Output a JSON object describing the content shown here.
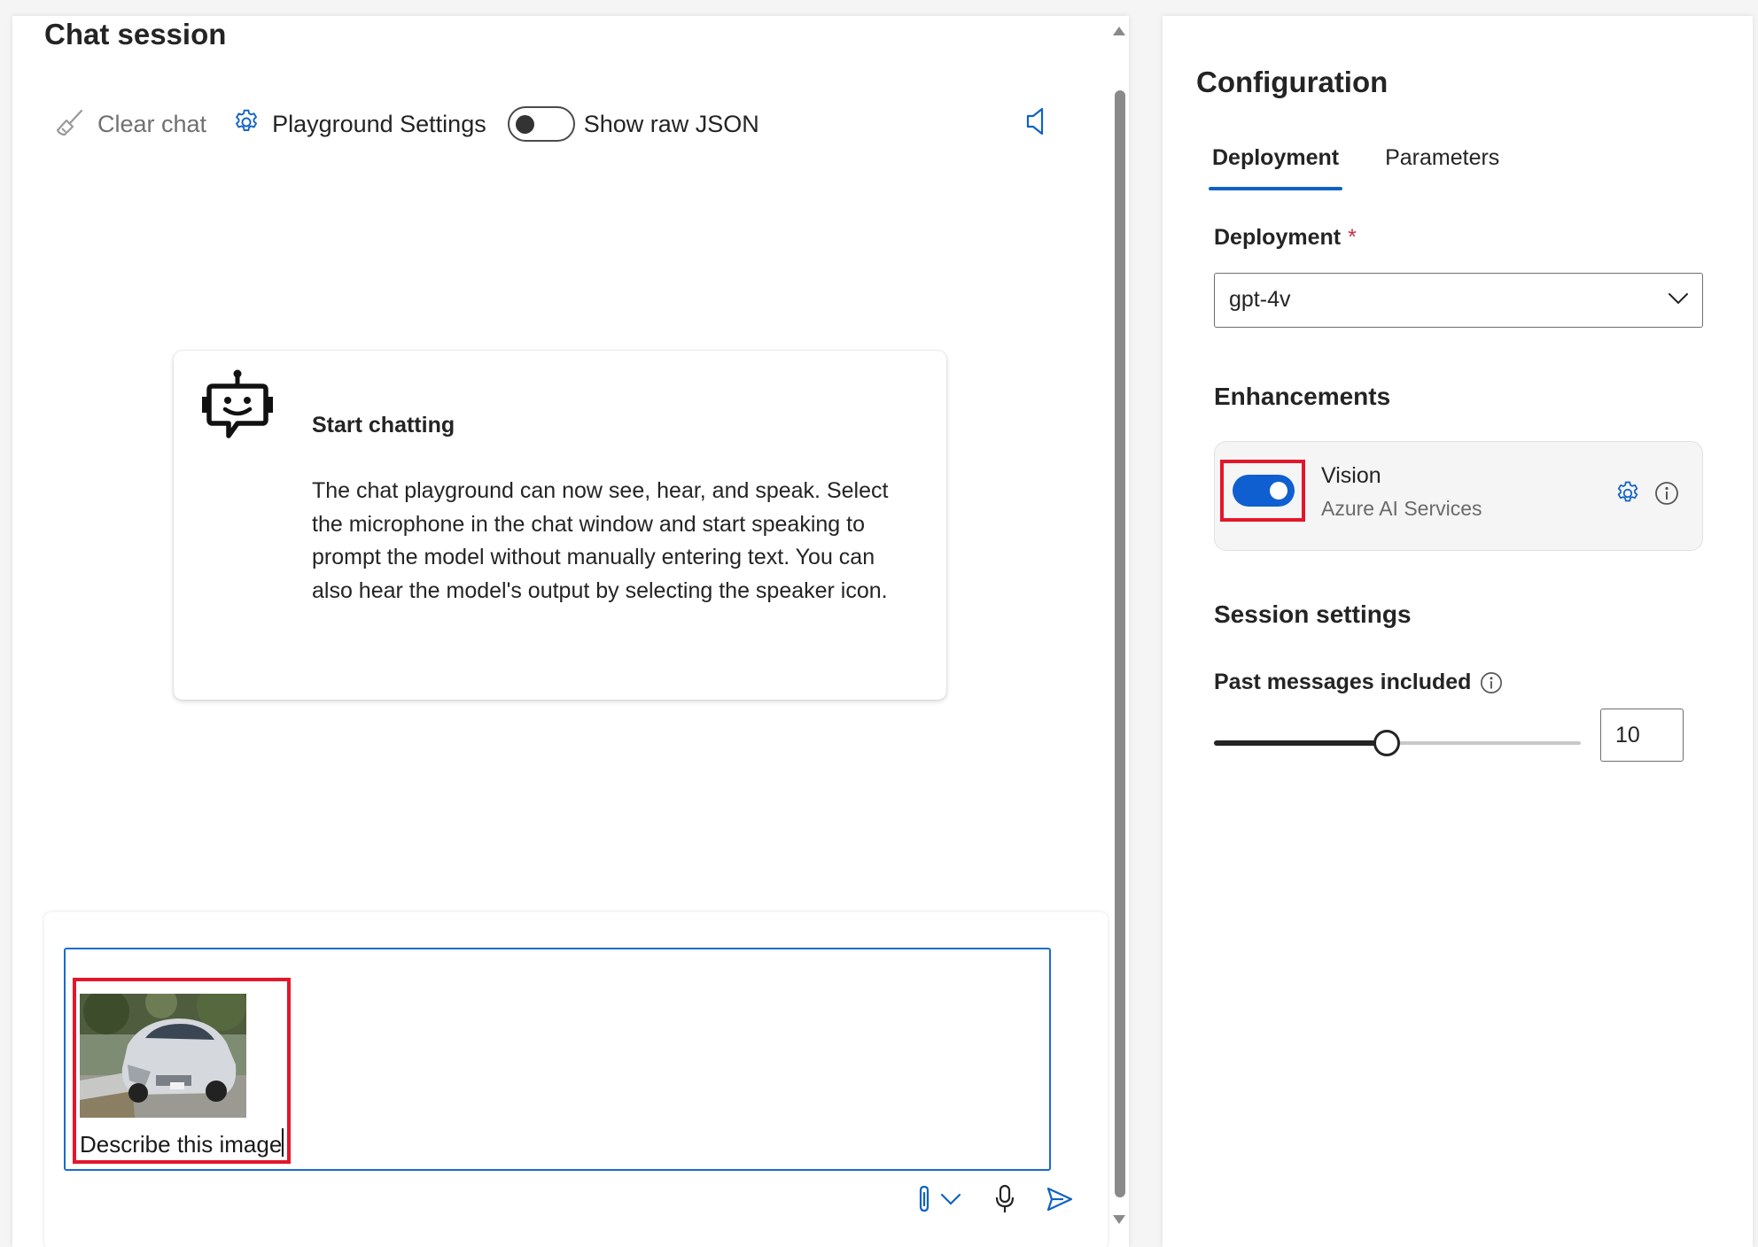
{
  "chat": {
    "title": "Chat session",
    "toolbar": {
      "clear_label": "Clear chat",
      "settings_label": "Playground Settings",
      "raw_json_label": "Show raw JSON",
      "raw_json_on": false
    },
    "intro": {
      "heading": "Start chatting",
      "body": "The chat playground can now see, hear, and speak. Select the microphone in the chat window and start speaking to prompt the model without manually entering text. You can also hear the model's output by selecting the speaker icon."
    },
    "input": {
      "text": "Describe this image",
      "attachment_icon": "car-photo-thumbnail"
    },
    "icons": {
      "clear": "broom-icon",
      "settings": "gear-icon",
      "speaker": "speaker-icon",
      "bot": "bot-icon",
      "attach": "paperclip-icon",
      "attach_menu": "chevron-down-icon",
      "mic": "microphone-icon",
      "send": "send-icon"
    }
  },
  "config": {
    "title": "Configuration",
    "tabs": [
      {
        "label": "Deployment",
        "active": true
      },
      {
        "label": "Parameters",
        "active": false
      }
    ],
    "deployment": {
      "label": "Deployment",
      "required_marker": "*",
      "value": "gpt-4v"
    },
    "enhancements": {
      "heading": "Enhancements",
      "items": [
        {
          "name": "Vision",
          "subtitle": "Azure AI Services",
          "enabled": true
        }
      ]
    },
    "session": {
      "heading": "Session settings",
      "past_messages_label": "Past messages included",
      "past_messages_value": "10",
      "slider_fraction": 0.47
    }
  },
  "colors": {
    "accent": "#0f62c4",
    "toggle_on": "#0f5fd0",
    "highlight": "#e3172b",
    "required": "#c4314b"
  }
}
